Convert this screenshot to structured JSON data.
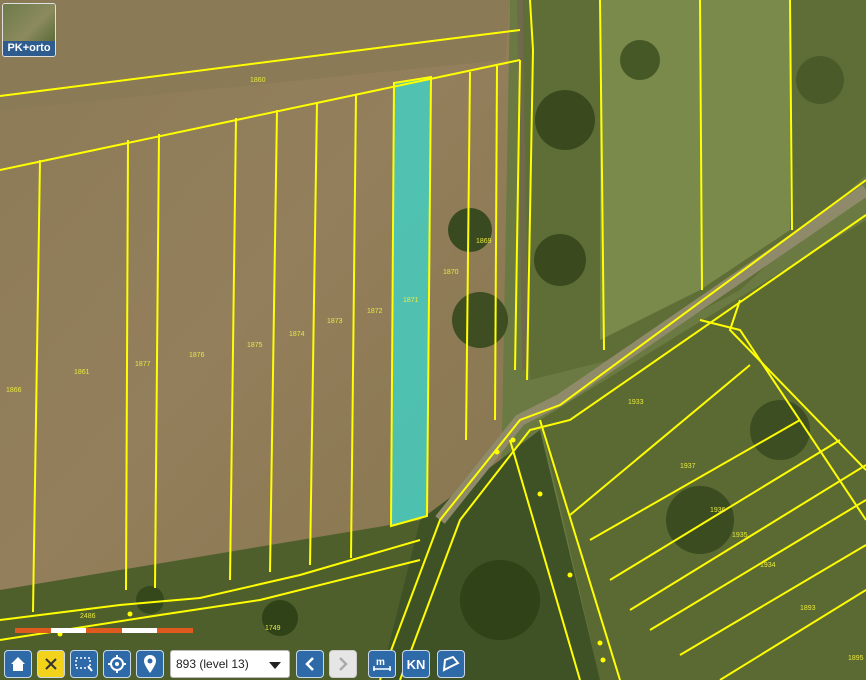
{
  "layer_switch": {
    "label": "PK+orto"
  },
  "parcel_labels": [
    {
      "id": "lbl-1860",
      "text": "1860"
    },
    {
      "id": "lbl-1869",
      "text": "1869"
    },
    {
      "id": "lbl-1870",
      "text": "1870"
    },
    {
      "id": "lbl-1871",
      "text": "1871"
    },
    {
      "id": "lbl-1872",
      "text": "1872"
    },
    {
      "id": "lbl-1873",
      "text": "1873"
    },
    {
      "id": "lbl-1874",
      "text": "1874"
    },
    {
      "id": "lbl-1875",
      "text": "1875"
    },
    {
      "id": "lbl-1876",
      "text": "1876"
    },
    {
      "id": "lbl-1877",
      "text": "1877"
    },
    {
      "id": "lbl-1861",
      "text": "1861"
    },
    {
      "id": "lbl-1866",
      "text": "1866"
    },
    {
      "id": "lbl-2486",
      "text": "2486"
    },
    {
      "id": "lbl-1749",
      "text": "1749"
    },
    {
      "id": "lbl-1933",
      "text": "1933"
    },
    {
      "id": "lbl-1937",
      "text": "1937"
    },
    {
      "id": "lbl-1936",
      "text": "1936"
    },
    {
      "id": "lbl-1935",
      "text": "1935"
    },
    {
      "id": "lbl-1934",
      "text": "1934"
    },
    {
      "id": "lbl-1893",
      "text": "1893"
    },
    {
      "id": "lbl-1895",
      "text": "1895"
    }
  ],
  "toolbar": {
    "parcel_select": "893 (level 13)",
    "kn_label": "KN"
  },
  "colors": {
    "parcel_boundary": "#ffff00",
    "selected_parcel": "#2ee6e0",
    "toolbar_button": "#2f6aa8",
    "toolbar_active": "#f2d21b"
  }
}
